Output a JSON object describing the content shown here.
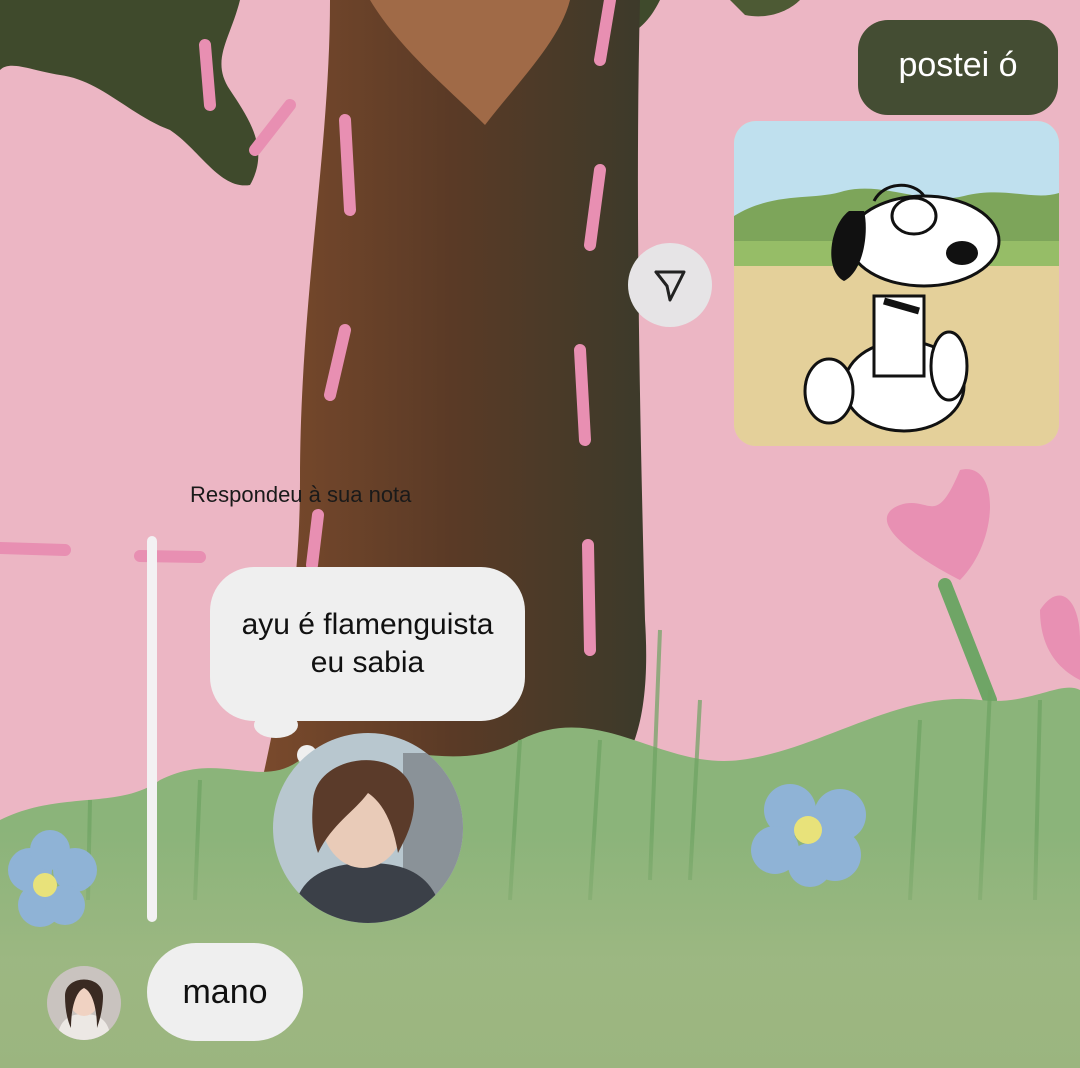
{
  "messages": {
    "outgoing_text": "postei ó",
    "sticker_icon": "snoopy-sticker",
    "share_icon": "send-icon",
    "reply_caption": "Respondeu à sua nota",
    "note_text": "ayu é flamenguista eu sabia",
    "incoming_text": "mano"
  },
  "colors": {
    "outgoing_bubble": "#444d33",
    "incoming_bubble": "#efefef",
    "background_pink": "#ecb6c4",
    "grass_green": "#9fb883"
  }
}
